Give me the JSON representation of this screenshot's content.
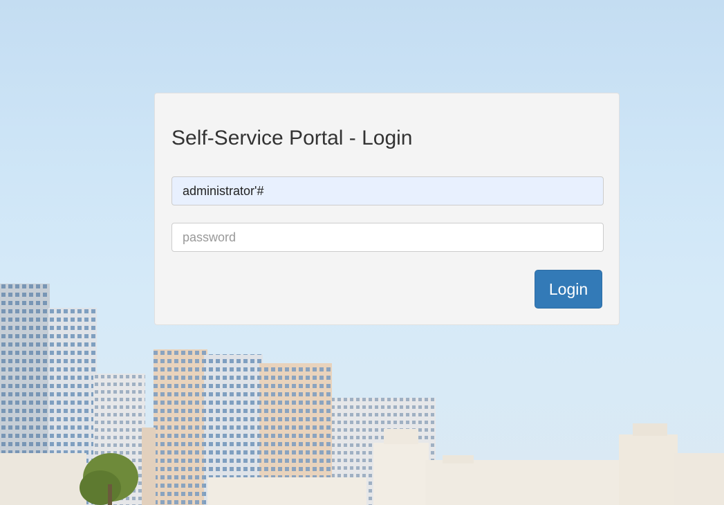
{
  "login": {
    "title": "Self-Service Portal - Login",
    "username_value": "administrator'#",
    "password_placeholder": "password",
    "button_label": "Login"
  },
  "colors": {
    "button_bg": "#337ab7",
    "card_bg": "#f4f4f4",
    "autofill_bg": "#e8f0fe"
  }
}
